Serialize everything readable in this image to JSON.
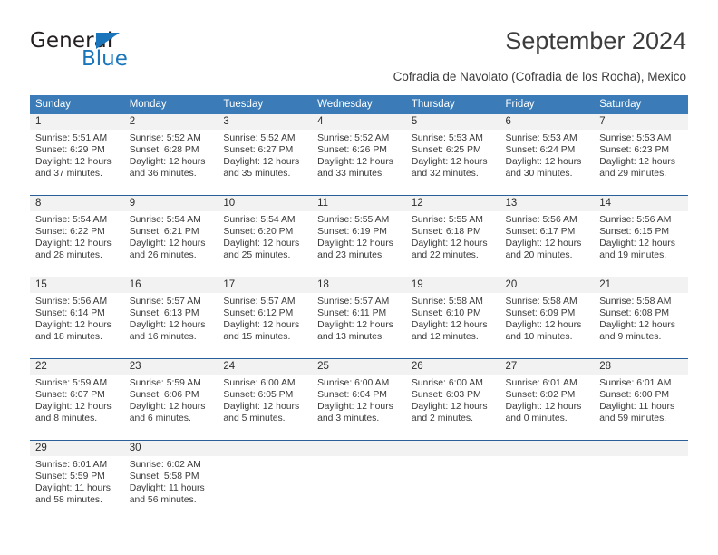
{
  "brand": {
    "name_dark": "General",
    "name_blue": "Blue",
    "accent_color": "#1b75bb"
  },
  "header": {
    "title": "September 2024",
    "subtitle": "Cofradia de Navolato (Cofradia de los Rocha), Mexico",
    "header_bg_color": "#3b7cb8",
    "row_separator_color": "#2a6099",
    "daynum_bg_color": "#f2f2f2"
  },
  "weekdays": [
    "Sunday",
    "Monday",
    "Tuesday",
    "Wednesday",
    "Thursday",
    "Friday",
    "Saturday"
  ],
  "weeks": [
    [
      {
        "day": "1",
        "sunrise": "Sunrise: 5:51 AM",
        "sunset": "Sunset: 6:29 PM",
        "daylight1": "Daylight: 12 hours",
        "daylight2": "and 37 minutes."
      },
      {
        "day": "2",
        "sunrise": "Sunrise: 5:52 AM",
        "sunset": "Sunset: 6:28 PM",
        "daylight1": "Daylight: 12 hours",
        "daylight2": "and 36 minutes."
      },
      {
        "day": "3",
        "sunrise": "Sunrise: 5:52 AM",
        "sunset": "Sunset: 6:27 PM",
        "daylight1": "Daylight: 12 hours",
        "daylight2": "and 35 minutes."
      },
      {
        "day": "4",
        "sunrise": "Sunrise: 5:52 AM",
        "sunset": "Sunset: 6:26 PM",
        "daylight1": "Daylight: 12 hours",
        "daylight2": "and 33 minutes."
      },
      {
        "day": "5",
        "sunrise": "Sunrise: 5:53 AM",
        "sunset": "Sunset: 6:25 PM",
        "daylight1": "Daylight: 12 hours",
        "daylight2": "and 32 minutes."
      },
      {
        "day": "6",
        "sunrise": "Sunrise: 5:53 AM",
        "sunset": "Sunset: 6:24 PM",
        "daylight1": "Daylight: 12 hours",
        "daylight2": "and 30 minutes."
      },
      {
        "day": "7",
        "sunrise": "Sunrise: 5:53 AM",
        "sunset": "Sunset: 6:23 PM",
        "daylight1": "Daylight: 12 hours",
        "daylight2": "and 29 minutes."
      }
    ],
    [
      {
        "day": "8",
        "sunrise": "Sunrise: 5:54 AM",
        "sunset": "Sunset: 6:22 PM",
        "daylight1": "Daylight: 12 hours",
        "daylight2": "and 28 minutes."
      },
      {
        "day": "9",
        "sunrise": "Sunrise: 5:54 AM",
        "sunset": "Sunset: 6:21 PM",
        "daylight1": "Daylight: 12 hours",
        "daylight2": "and 26 minutes."
      },
      {
        "day": "10",
        "sunrise": "Sunrise: 5:54 AM",
        "sunset": "Sunset: 6:20 PM",
        "daylight1": "Daylight: 12 hours",
        "daylight2": "and 25 minutes."
      },
      {
        "day": "11",
        "sunrise": "Sunrise: 5:55 AM",
        "sunset": "Sunset: 6:19 PM",
        "daylight1": "Daylight: 12 hours",
        "daylight2": "and 23 minutes."
      },
      {
        "day": "12",
        "sunrise": "Sunrise: 5:55 AM",
        "sunset": "Sunset: 6:18 PM",
        "daylight1": "Daylight: 12 hours",
        "daylight2": "and 22 minutes."
      },
      {
        "day": "13",
        "sunrise": "Sunrise: 5:56 AM",
        "sunset": "Sunset: 6:17 PM",
        "daylight1": "Daylight: 12 hours",
        "daylight2": "and 20 minutes."
      },
      {
        "day": "14",
        "sunrise": "Sunrise: 5:56 AM",
        "sunset": "Sunset: 6:15 PM",
        "daylight1": "Daylight: 12 hours",
        "daylight2": "and 19 minutes."
      }
    ],
    [
      {
        "day": "15",
        "sunrise": "Sunrise: 5:56 AM",
        "sunset": "Sunset: 6:14 PM",
        "daylight1": "Daylight: 12 hours",
        "daylight2": "and 18 minutes."
      },
      {
        "day": "16",
        "sunrise": "Sunrise: 5:57 AM",
        "sunset": "Sunset: 6:13 PM",
        "daylight1": "Daylight: 12 hours",
        "daylight2": "and 16 minutes."
      },
      {
        "day": "17",
        "sunrise": "Sunrise: 5:57 AM",
        "sunset": "Sunset: 6:12 PM",
        "daylight1": "Daylight: 12 hours",
        "daylight2": "and 15 minutes."
      },
      {
        "day": "18",
        "sunrise": "Sunrise: 5:57 AM",
        "sunset": "Sunset: 6:11 PM",
        "daylight1": "Daylight: 12 hours",
        "daylight2": "and 13 minutes."
      },
      {
        "day": "19",
        "sunrise": "Sunrise: 5:58 AM",
        "sunset": "Sunset: 6:10 PM",
        "daylight1": "Daylight: 12 hours",
        "daylight2": "and 12 minutes."
      },
      {
        "day": "20",
        "sunrise": "Sunrise: 5:58 AM",
        "sunset": "Sunset: 6:09 PM",
        "daylight1": "Daylight: 12 hours",
        "daylight2": "and 10 minutes."
      },
      {
        "day": "21",
        "sunrise": "Sunrise: 5:58 AM",
        "sunset": "Sunset: 6:08 PM",
        "daylight1": "Daylight: 12 hours",
        "daylight2": "and 9 minutes."
      }
    ],
    [
      {
        "day": "22",
        "sunrise": "Sunrise: 5:59 AM",
        "sunset": "Sunset: 6:07 PM",
        "daylight1": "Daylight: 12 hours",
        "daylight2": "and 8 minutes."
      },
      {
        "day": "23",
        "sunrise": "Sunrise: 5:59 AM",
        "sunset": "Sunset: 6:06 PM",
        "daylight1": "Daylight: 12 hours",
        "daylight2": "and 6 minutes."
      },
      {
        "day": "24",
        "sunrise": "Sunrise: 6:00 AM",
        "sunset": "Sunset: 6:05 PM",
        "daylight1": "Daylight: 12 hours",
        "daylight2": "and 5 minutes."
      },
      {
        "day": "25",
        "sunrise": "Sunrise: 6:00 AM",
        "sunset": "Sunset: 6:04 PM",
        "daylight1": "Daylight: 12 hours",
        "daylight2": "and 3 minutes."
      },
      {
        "day": "26",
        "sunrise": "Sunrise: 6:00 AM",
        "sunset": "Sunset: 6:03 PM",
        "daylight1": "Daylight: 12 hours",
        "daylight2": "and 2 minutes."
      },
      {
        "day": "27",
        "sunrise": "Sunrise: 6:01 AM",
        "sunset": "Sunset: 6:02 PM",
        "daylight1": "Daylight: 12 hours",
        "daylight2": "and 0 minutes."
      },
      {
        "day": "28",
        "sunrise": "Sunrise: 6:01 AM",
        "sunset": "Sunset: 6:00 PM",
        "daylight1": "Daylight: 11 hours",
        "daylight2": "and 59 minutes."
      }
    ],
    [
      {
        "day": "29",
        "sunrise": "Sunrise: 6:01 AM",
        "sunset": "Sunset: 5:59 PM",
        "daylight1": "Daylight: 11 hours",
        "daylight2": "and 58 minutes."
      },
      {
        "day": "30",
        "sunrise": "Sunrise: 6:02 AM",
        "sunset": "Sunset: 5:58 PM",
        "daylight1": "Daylight: 11 hours",
        "daylight2": "and 56 minutes."
      },
      {
        "day": "",
        "sunrise": "",
        "sunset": "",
        "daylight1": "",
        "daylight2": ""
      },
      {
        "day": "",
        "sunrise": "",
        "sunset": "",
        "daylight1": "",
        "daylight2": ""
      },
      {
        "day": "",
        "sunrise": "",
        "sunset": "",
        "daylight1": "",
        "daylight2": ""
      },
      {
        "day": "",
        "sunrise": "",
        "sunset": "",
        "daylight1": "",
        "daylight2": ""
      },
      {
        "day": "",
        "sunrise": "",
        "sunset": "",
        "daylight1": "",
        "daylight2": ""
      }
    ]
  ]
}
